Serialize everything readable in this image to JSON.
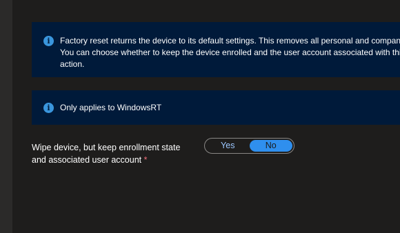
{
  "banners": {
    "reset": {
      "icon": "info-icon",
      "lines": [
        "Factory reset returns the device to its default settings. This removes all personal and company",
        "You can choose whether to keep the device enrolled and the user account associated with this",
        "action."
      ]
    },
    "windows": {
      "icon": "info-icon",
      "text": "Only applies to WindowsRT"
    }
  },
  "wipe_setting": {
    "label_line1": "Wipe device, but keep enrollment state",
    "label_line2": "and associated user account",
    "required_marker": "*",
    "options": [
      "Yes",
      "No"
    ],
    "selected": "No"
  },
  "colors": {
    "background": "#1e1d1c",
    "banner_bg": "#001a3a",
    "info_icon": "#3a96dd",
    "toggle_selected": "#2f8fee",
    "required": "#f1707b"
  }
}
